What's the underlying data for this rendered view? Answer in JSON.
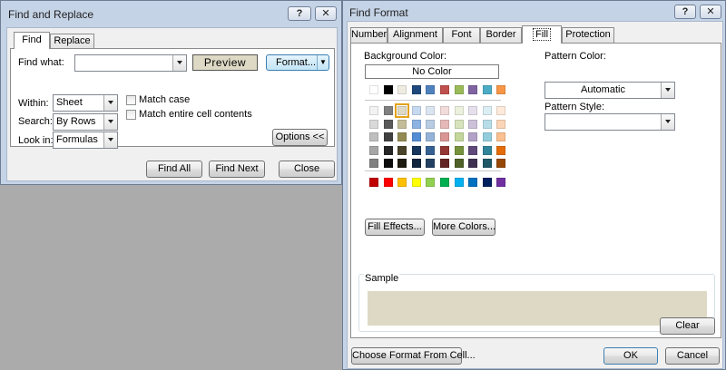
{
  "find_replace": {
    "title": "Find and Replace",
    "tabs": [
      "Find",
      "Replace"
    ],
    "find_what_label": "Find what:",
    "find_what_value": "",
    "preview_label": "Preview",
    "format_label": "Format...",
    "within_label": "Within:",
    "within_value": "Sheet",
    "search_label": "Search:",
    "search_value": "By Rows",
    "lookin_label": "Look in:",
    "lookin_value": "Formulas",
    "match_case_label": "Match case",
    "match_entire_label": "Match entire cell contents",
    "options_label": "Options <<",
    "find_all_label": "Find All",
    "find_next_label": "Find Next",
    "close_label": "Close",
    "preview_color": "#ddd9c4"
  },
  "find_format": {
    "title": "Find Format",
    "tabs": [
      "Number",
      "Alignment",
      "Font",
      "Border",
      "Fill",
      "Protection"
    ],
    "active_tab": "Fill",
    "background_color_label": "Background Color:",
    "no_color_label": "No Color",
    "pattern_color_label": "Pattern Color:",
    "pattern_color_value": "Automatic",
    "pattern_style_label": "Pattern Style:",
    "pattern_style_value": "",
    "fill_effects_label": "Fill Effects...",
    "more_colors_label": "More Colors...",
    "sample_label": "Sample",
    "sample_color": "#ddd9c4",
    "clear_label": "Clear",
    "choose_format_label": "Choose Format From Cell...",
    "ok_label": "OK",
    "cancel_label": "Cancel",
    "selected_swatch": "#ddd9c4",
    "basic_row": [
      "#ffffff",
      "#000000",
      "#eeece1",
      "#1f497d",
      "#4f81bd",
      "#c0504d",
      "#9bbb59",
      "#8064a2",
      "#4bacc6",
      "#f79646"
    ],
    "theme_rows": [
      [
        "#f2f2f2",
        "#808080",
        "#ddd9c4",
        "#c6d9f0",
        "#dbe5f1",
        "#f2dcdb",
        "#ebf1dd",
        "#e5e0ec",
        "#dbeef3",
        "#fdeada"
      ],
      [
        "#d9d9d9",
        "#595959",
        "#c4bd97",
        "#8db3e2",
        "#b8cce4",
        "#e5b9b7",
        "#d7e3bc",
        "#ccc1d9",
        "#b7dde8",
        "#fbd5b5"
      ],
      [
        "#bfbfbf",
        "#404040",
        "#938953",
        "#548dd4",
        "#95b3d7",
        "#d99694",
        "#c3d69b",
        "#b2a2c7",
        "#92cddc",
        "#fac08f"
      ],
      [
        "#a6a6a6",
        "#262626",
        "#494429",
        "#17365d",
        "#366092",
        "#953734",
        "#76923c",
        "#5f497a",
        "#31859b",
        "#e36c09"
      ],
      [
        "#808080",
        "#0d0d0d",
        "#1d1b10",
        "#0f243e",
        "#244061",
        "#632423",
        "#4f6128",
        "#3f3151",
        "#205867",
        "#974806"
      ]
    ],
    "standard_row": [
      "#c00000",
      "#ff0000",
      "#ffc000",
      "#ffff00",
      "#92d050",
      "#00b050",
      "#00b0f0",
      "#0070c0",
      "#002060",
      "#7030a0"
    ]
  }
}
